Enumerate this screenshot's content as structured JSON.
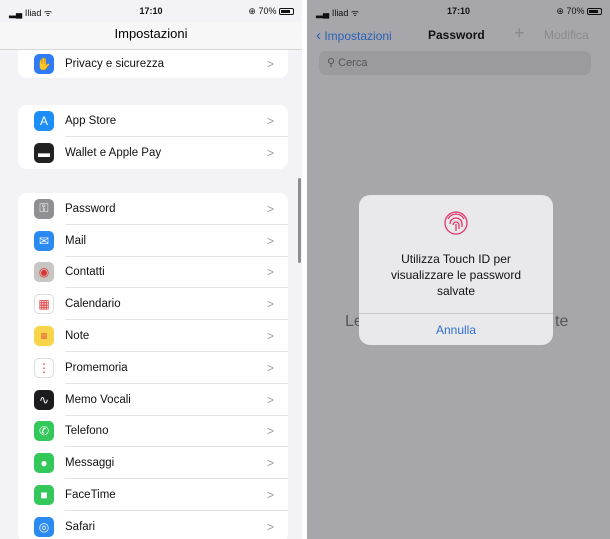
{
  "status": {
    "carrier": "Iliad",
    "time": "17:10",
    "battery": "70%"
  },
  "left": {
    "title": "Impostazioni",
    "groups": [
      [
        {
          "label": "Privacy e sicurezza",
          "icon": "hand-icon",
          "color": "#2f7cf6"
        }
      ],
      [
        {
          "label": "App Store",
          "icon": "app-store-icon",
          "color": "#1c8ef5"
        },
        {
          "label": "Wallet e Apple Pay",
          "icon": "wallet-icon",
          "color": "#222222"
        }
      ],
      [
        {
          "label": "Password",
          "icon": "key-icon",
          "color": "#8e8e93"
        },
        {
          "label": "Mail",
          "icon": "mail-icon",
          "color": "#2a8af0"
        },
        {
          "label": "Contatti",
          "icon": "contacts-icon",
          "color": "#c8c6c2"
        },
        {
          "label": "Calendario",
          "icon": "calendar-icon",
          "color": "#ffffff"
        },
        {
          "label": "Note",
          "icon": "notes-icon",
          "color": "#f8d44a"
        },
        {
          "label": "Promemoria",
          "icon": "reminders-icon",
          "color": "#ffffff"
        },
        {
          "label": "Memo Vocali",
          "icon": "voice-memos-icon",
          "color": "#1c1c1e"
        },
        {
          "label": "Telefono",
          "icon": "phone-icon",
          "color": "#34c759"
        },
        {
          "label": "Messaggi",
          "icon": "messages-icon",
          "color": "#34c759"
        },
        {
          "label": "FaceTime",
          "icon": "facetime-icon",
          "color": "#34c759"
        },
        {
          "label": "Safari",
          "icon": "safari-icon",
          "color": "#2a8af0"
        }
      ]
    ]
  },
  "right": {
    "back": "Impostazioni",
    "title": "Password",
    "add": "+",
    "edit": "Modifica",
    "search_placeholder": "Cerca",
    "bg_left": "Le",
    "bg_right": "te",
    "dialog": {
      "message": "Utilizza Touch ID per visualizzare le password salvate",
      "cancel": "Annulla",
      "icon_color": "#e0366a"
    }
  }
}
